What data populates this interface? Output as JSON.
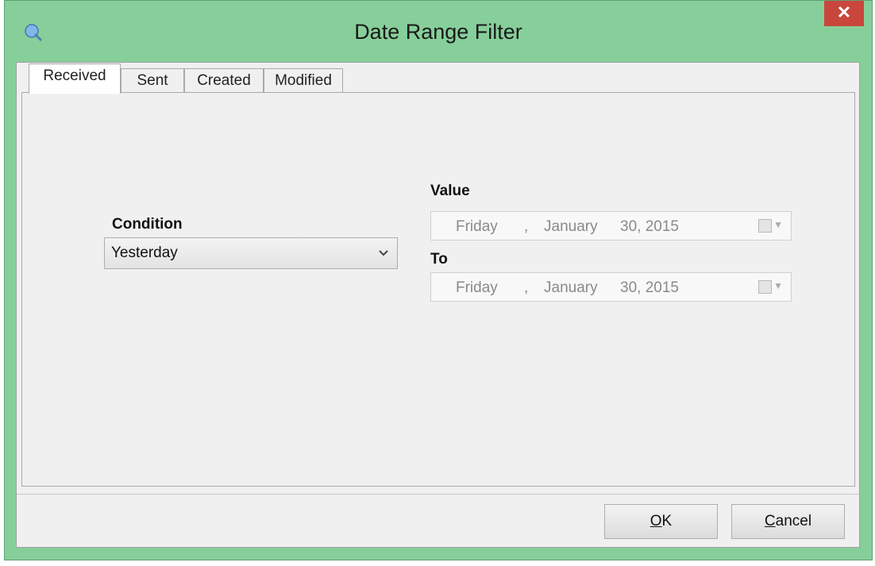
{
  "window": {
    "title": "Date Range Filter",
    "close_label": "✕"
  },
  "tabs": [
    {
      "label": "Received",
      "active": true
    },
    {
      "label": "Sent",
      "active": false
    },
    {
      "label": "Created",
      "active": false
    },
    {
      "label": "Modified",
      "active": false
    }
  ],
  "condition": {
    "label": "Condition",
    "selected": "Yesterday"
  },
  "value": {
    "label": "Value",
    "day": "Friday",
    "sep": ",",
    "month": "January",
    "date": "30, 2015"
  },
  "to": {
    "label": "To",
    "day": "Friday",
    "sep": ",",
    "month": "January",
    "date": "30, 2015"
  },
  "buttons": {
    "ok_mnemonic": "O",
    "ok_rest": "K",
    "cancel_mnemonic": "C",
    "cancel_rest": "ancel"
  },
  "colors": {
    "frame": "#87cf9a",
    "close": "#c9463d"
  },
  "icons": {
    "app": "app-icon",
    "close": "close-icon",
    "dropdown": "chevron-down-icon",
    "calendar": "calendar-icon"
  }
}
